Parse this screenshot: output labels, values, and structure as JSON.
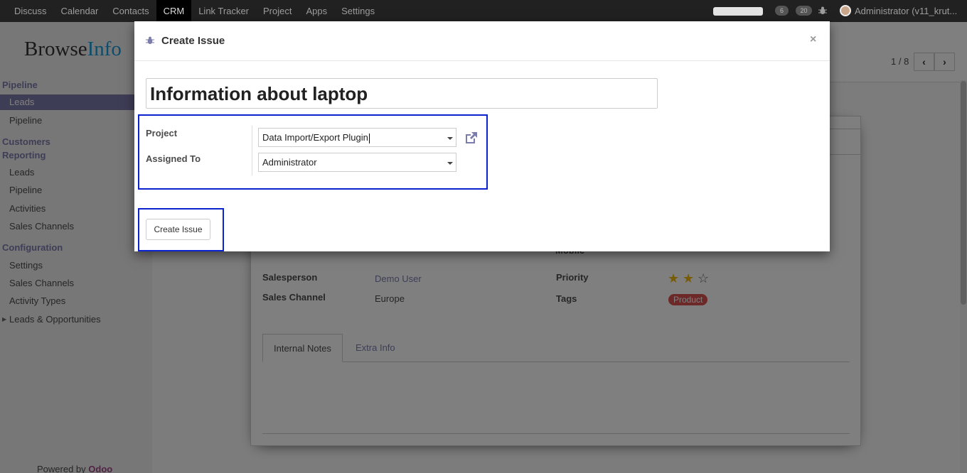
{
  "topnav": {
    "menu": [
      "Discuss",
      "Calendar",
      "Contacts",
      "CRM",
      "Link Tracker",
      "Project",
      "Apps",
      "Settings"
    ],
    "active": "CRM",
    "badges": [
      "6",
      "20"
    ],
    "user": "Administrator (v11_krut..."
  },
  "sidebar": {
    "brand_a": "Browse",
    "brand_b": "Info",
    "sections": {
      "pipeline": "Pipeline",
      "customers": "Customers",
      "reporting": "Reporting",
      "configuration": "Configuration"
    },
    "pipeline_items": [
      "Leads",
      "Pipeline"
    ],
    "reporting_items": [
      "Leads",
      "Pipeline",
      "Activities",
      "Sales Channels"
    ],
    "config_items": [
      "Settings",
      "Sales Channels",
      "Activity Types",
      "Leads & Opportunities"
    ],
    "footer_a": "Powered by ",
    "footer_b": "Odoo"
  },
  "main": {
    "pager": "1 / 8",
    "partial_label": "Mobile",
    "salesperson_label": "Salesperson",
    "salesperson": "Demo User",
    "sales_channel_label": "Sales Channel",
    "sales_channel": "Europe",
    "priority_label": "Priority",
    "priority_stars": 2,
    "priority_max": 3,
    "tags_label": "Tags",
    "tag": "Product",
    "tabs": [
      "Internal Notes",
      "Extra Info"
    ]
  },
  "modal": {
    "title": "Create Issue",
    "close": "×",
    "issue_name": "Information about laptop",
    "project_label": "Project",
    "project_value": "Data Import/Export Plugin",
    "assigned_label": "Assigned To",
    "assigned_value": "Administrator",
    "create_button": "Create Issue"
  },
  "colors": {
    "accent": "#7c7bad",
    "highlight": "#0b22cf",
    "tag": "#d9534f",
    "star": "#f0b90b"
  }
}
